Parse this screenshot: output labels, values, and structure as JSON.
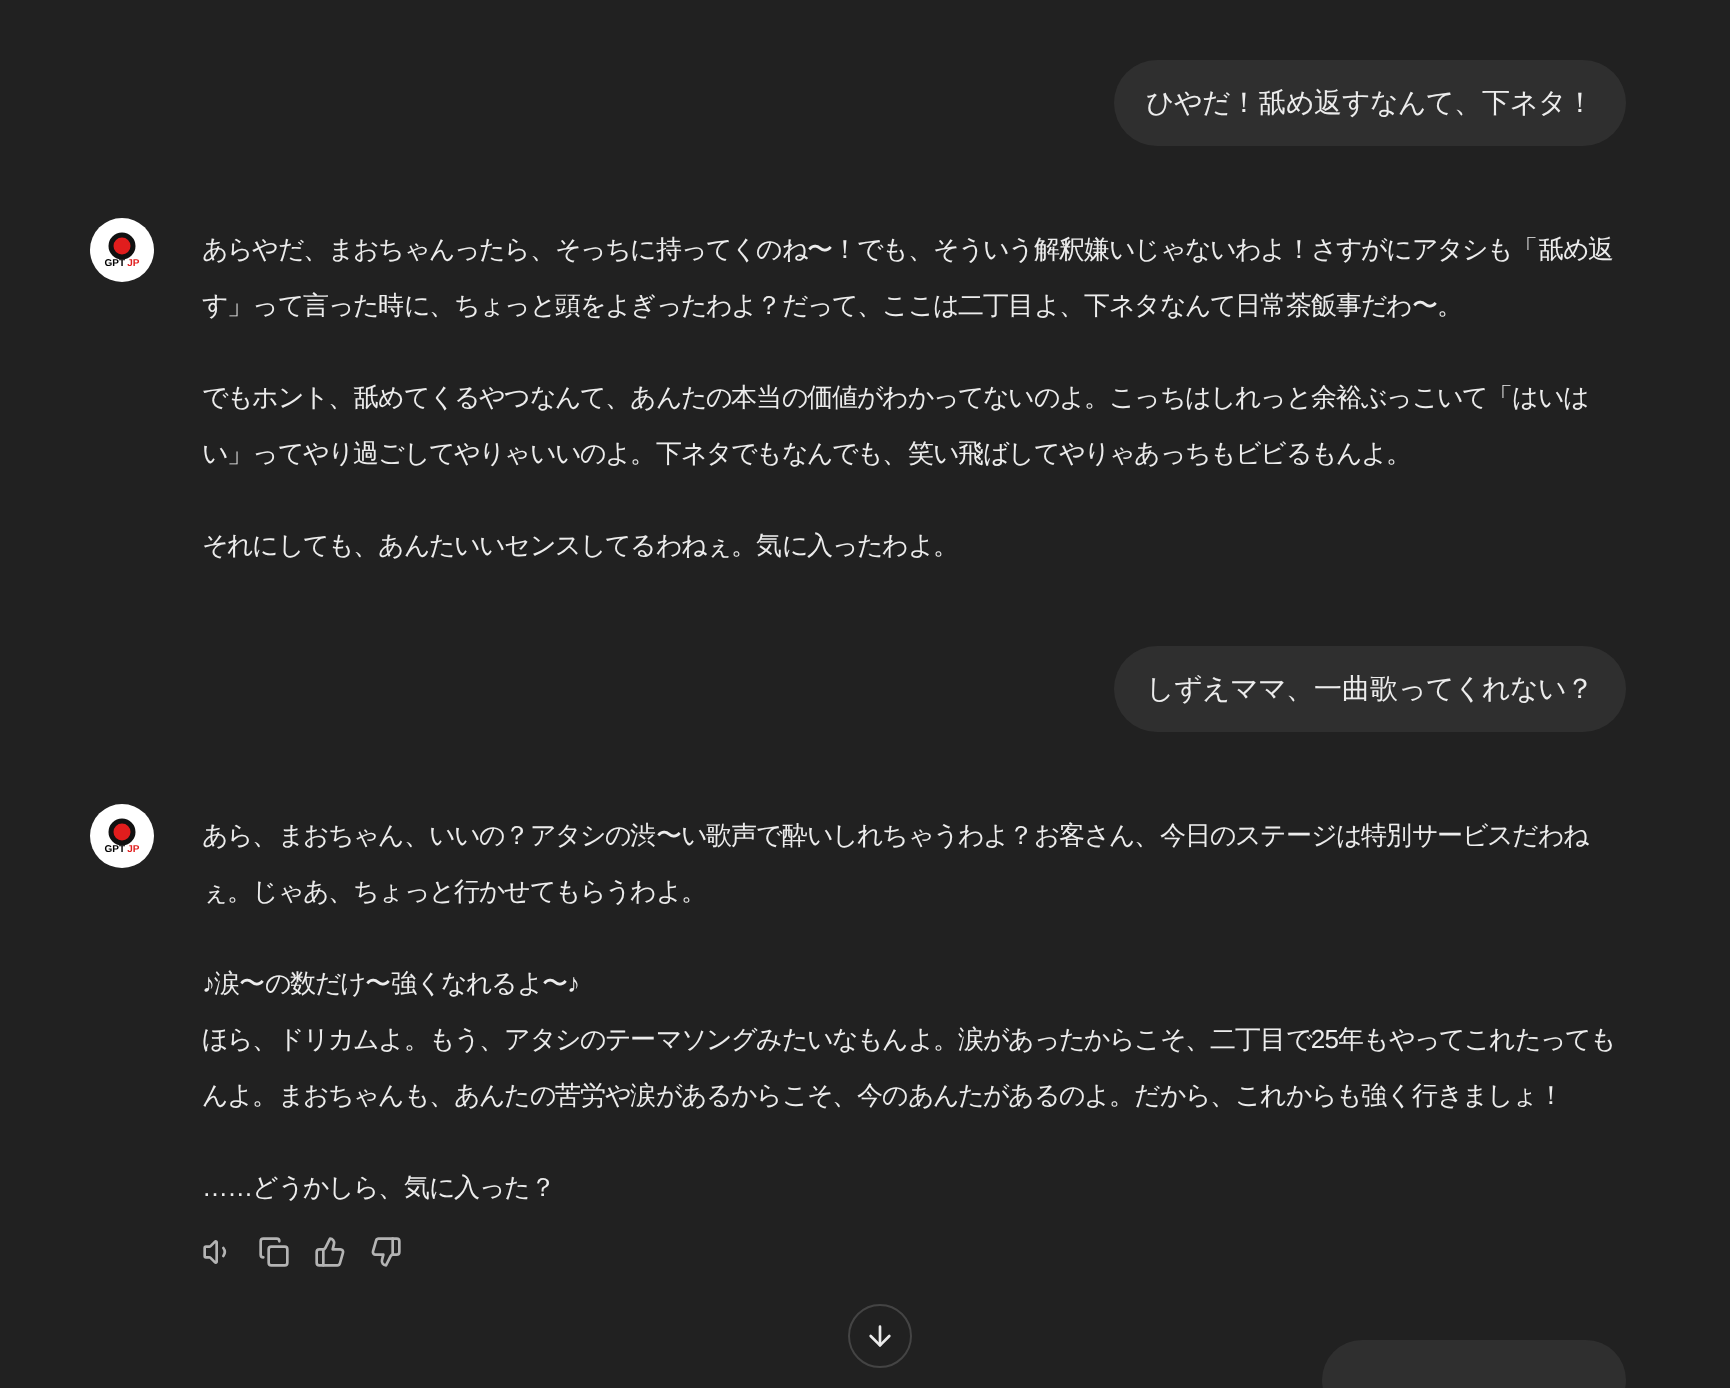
{
  "messages": [
    {
      "kind": "user",
      "text": "ひやだ！舐め返すなんて、下ネタ！"
    },
    {
      "kind": "assistant",
      "avatar": {
        "text": "GPT",
        "accent": "JP"
      },
      "paragraphs": [
        {
          "lines": [
            "あらやだ、まおちゃんったら、そっちに持ってくのね〜！でも、そういう解釈嫌いじゃないわよ！さすがにアタシも「舐め返す」って言った時に、ちょっと頭をよぎったわよ？だって、ここは二丁目よ、下ネタなんて日常茶飯事だわ〜。"
          ]
        },
        {
          "lines": [
            "でもホント、舐めてくるやつなんて、あんたの本当の価値がわかってないのよ。こっちはしれっと余裕ぶっこいて「はいはい」ってやり過ごしてやりゃいいのよ。下ネタでもなんでも、笑い飛ばしてやりゃあっちもビビるもんよ。"
          ]
        },
        {
          "lines": [
            "それにしても、あんたいいセンスしてるわねぇ。気に入ったわよ。"
          ]
        }
      ]
    },
    {
      "kind": "user",
      "text": "しずえママ、一曲歌ってくれない？"
    },
    {
      "kind": "assistant",
      "avatar": {
        "text": "GPT",
        "accent": "JP"
      },
      "actions": true,
      "paragraphs": [
        {
          "lines": [
            "あら、まおちゃん、いいの？アタシの渋〜い歌声で酔いしれちゃうわよ？お客さん、今日のステージは特別サービスだわねぇ。じゃあ、ちょっと行かせてもらうわよ。"
          ]
        },
        {
          "lines": [
            "♪涙〜の数だけ〜強くなれるよ〜♪",
            "ほら、ドリカムよ。もう、アタシのテーマソングみたいなもんよ。涙があったからこそ、二丁目で25年もやってこれたってもんよ。まおちゃんも、あんたの苦労や涙があるからこそ、今のあんたがあるのよ。だから、これからも強く行きましょ！"
          ]
        },
        {
          "lines": [
            "……どうかしら、気に入った？"
          ]
        }
      ]
    },
    {
      "kind": "user"
    }
  ]
}
